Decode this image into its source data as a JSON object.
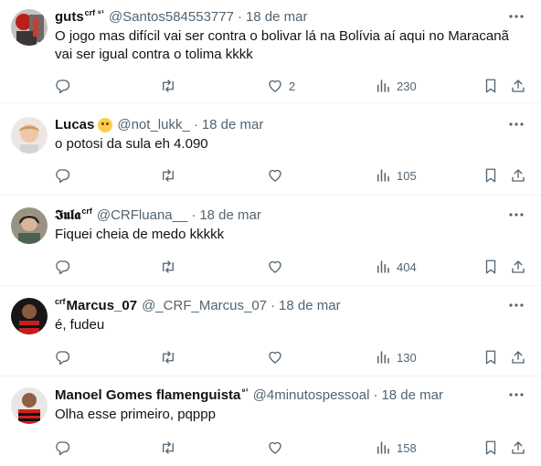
{
  "tweets": [
    {
      "name": "guts",
      "name_sup": "crf ⁸¹",
      "handle": "@Santos584553777",
      "separator": "·",
      "date": "18 de mar",
      "text": "O jogo mas difícil vai ser contra o bolivar lá na Bolívia aí aqui no Maracanã vai ser igual contra o tolima kkkk",
      "likes": "2",
      "views": "230"
    },
    {
      "name": "Lucas",
      "emoji": "grinning-sweat-emoji",
      "handle": "@not_lukk_",
      "separator": "·",
      "date": "18 de mar",
      "text": "o potosi da sula eh 4.090",
      "views": "105"
    },
    {
      "name": "𝕴𝖚𝖑𝖆",
      "name_sup": "crf",
      "handle": "@CRFluana__",
      "separator": "·",
      "date": "18 de mar",
      "text": "Fiquei cheia de medo kkkkk",
      "views": "404"
    },
    {
      "name_pre": "crf",
      "name": "Marcus_07",
      "handle": "@_CRF_Marcus_07",
      "separator": "·",
      "date": "18 de mar",
      "text": "é, fudeu",
      "views": "130"
    },
    {
      "name": "Manoel Gomes flamenguista",
      "name_sup": "⁸¹",
      "handle": "@4minutospessoal",
      "separator": "·",
      "date": "18 de mar",
      "text": "Olha esse primeiro, pqppp",
      "views": "158"
    }
  ],
  "icons": [
    "reply-icon",
    "retweet-icon",
    "like-icon",
    "views-icon",
    "bookmark-icon",
    "share-icon",
    "more-icon"
  ],
  "colors": {
    "text": "#0f1419",
    "secondary": "#536471",
    "divider": "#eff3f4"
  }
}
